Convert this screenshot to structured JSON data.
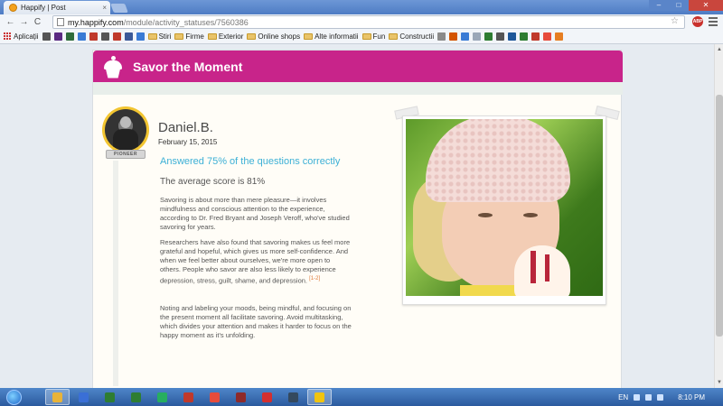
{
  "browser": {
    "tab_title": "Happify | Post",
    "tab_close": "×",
    "url_host": "my.happify.com",
    "url_path": "/module/activity_statuses/7560386",
    "back": "←",
    "forward": "→",
    "reload": "C",
    "star": "☆",
    "ext_abp": "ABP",
    "win_min": "–",
    "win_max": "□",
    "win_close": "✕"
  },
  "bookmarks": [
    {
      "label": "Aplicații",
      "type": "apps"
    },
    {
      "label": "",
      "type": "icon",
      "color": "#555555"
    },
    {
      "label": "",
      "type": "icon",
      "color": "#5a2a82"
    },
    {
      "label": "",
      "type": "icon",
      "color": "#2e6b3a"
    },
    {
      "label": "",
      "type": "icon",
      "color": "#3a7bd5"
    },
    {
      "label": "",
      "type": "icon",
      "color": "#c0392b"
    },
    {
      "label": "",
      "type": "icon",
      "color": "#555555"
    },
    {
      "label": "",
      "type": "icon",
      "color": "#c0392b"
    },
    {
      "label": "",
      "type": "icon",
      "color": "#3b5998"
    },
    {
      "label": "",
      "type": "icon",
      "color": "#3a7bd5"
    },
    {
      "label": "Stiri",
      "type": "folder"
    },
    {
      "label": "Firme",
      "type": "folder"
    },
    {
      "label": "Exterior",
      "type": "folder"
    },
    {
      "label": "Online shops",
      "type": "folder"
    },
    {
      "label": "Alte informatii",
      "type": "folder"
    },
    {
      "label": "Fun",
      "type": "folder"
    },
    {
      "label": "Constructii",
      "type": "folder"
    },
    {
      "label": "",
      "type": "icon",
      "color": "#8a8a8a"
    },
    {
      "label": "",
      "type": "icon",
      "color": "#d35400"
    },
    {
      "label": "",
      "type": "icon",
      "color": "#3a7bd5"
    },
    {
      "label": "",
      "type": "icon",
      "color": "#9aa7b8"
    },
    {
      "label": "",
      "type": "icon",
      "color": "#2e7d32"
    },
    {
      "label": "",
      "type": "icon",
      "color": "#555555"
    },
    {
      "label": "",
      "type": "icon",
      "color": "#1e5799"
    },
    {
      "label": "",
      "type": "icon",
      "color": "#2e7d32"
    },
    {
      "label": "",
      "type": "icon",
      "color": "#c0392b"
    },
    {
      "label": "",
      "type": "icon",
      "color": "#e74c3c"
    },
    {
      "label": "",
      "type": "icon",
      "color": "#e67e22"
    }
  ],
  "card": {
    "title": "Savor the Moment",
    "badge": "PIONEER",
    "user_name": "Daniel.B.",
    "date": "February 15, 2015",
    "answered": "Answered 75% of the questions correctly",
    "average": "The average score is 81%",
    "p1": "Savoring is about more than mere pleasure—it involves mindfulness and conscious attention to the experience, according to Dr. Fred Bryant and Joseph Veroff, who've studied savoring for years.",
    "p2": "Researchers have also found that savoring makes us feel more grateful and hopeful, which gives us more self-confidence. And when we feel better about ourselves, we're more open to others. People who savor are also less likely to experience depression, stress, guilt, shame, and depression.",
    "p2_cite": "[1-2]",
    "p3": "Noting and labeling your moods, being mindful, and focusing on the present moment all facilitate savoring. Avoid multitasking, which divides your attention and makes it harder to focus on the happy moment as it's unfolding."
  },
  "colors": {
    "header": "#c8248a",
    "answered": "#3cb0d6",
    "cite": "#e07b39"
  },
  "taskbar": {
    "apps": [
      {
        "name": "chrome-taskbar-icon",
        "color": "#e8b339",
        "active": true
      },
      {
        "name": "app-taskbar-icon-2",
        "color": "#3a6fd6",
        "active": false
      },
      {
        "name": "excel-taskbar-icon",
        "color": "#2e7d32",
        "active": false
      },
      {
        "name": "app-taskbar-icon-4",
        "color": "#2e7d32",
        "active": false
      },
      {
        "name": "app-taskbar-icon-5",
        "color": "#27ae60",
        "active": false
      },
      {
        "name": "app-taskbar-icon-6",
        "color": "#c0392b",
        "active": false
      },
      {
        "name": "app-taskbar-icon-7",
        "color": "#e74c3c",
        "active": false
      },
      {
        "name": "app-taskbar-icon-8",
        "color": "#8e2a2a",
        "active": false
      },
      {
        "name": "acrobat-taskbar-icon",
        "color": "#d32f2f",
        "active": false
      },
      {
        "name": "app-taskbar-icon-10",
        "color": "#34495e",
        "active": false
      },
      {
        "name": "explorer-taskbar-icon",
        "color": "#f1c40f",
        "active": true
      }
    ],
    "lang": "EN",
    "time": "8:10 PM"
  }
}
